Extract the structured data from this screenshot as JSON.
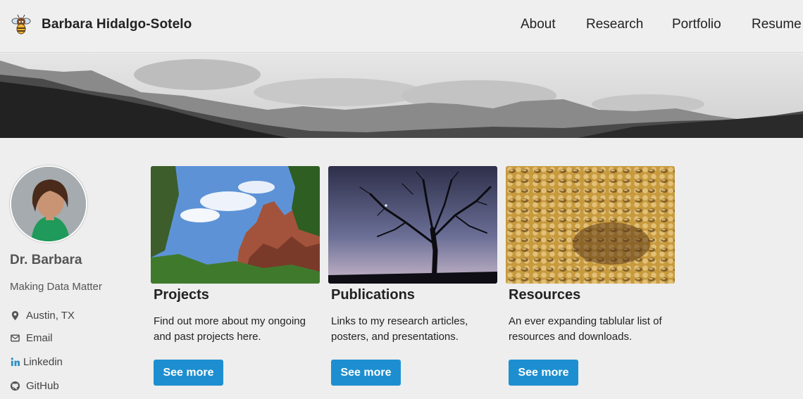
{
  "masthead": {
    "site_title": "Barbara Hidalgo-Sotelo",
    "logo_icon": "bee-logo-icon",
    "nav": [
      {
        "label": "About"
      },
      {
        "label": "Research"
      },
      {
        "label": "Portfolio"
      },
      {
        "label": "Resume"
      }
    ]
  },
  "hero": {
    "description": "mountain-panorama-grayscale"
  },
  "author": {
    "name": "Dr. Barbara",
    "bio": "Making Data Matter",
    "links": [
      {
        "label": "Austin, TX",
        "icon": "location-pin-icon"
      },
      {
        "label": "Email",
        "icon": "envelope-icon"
      },
      {
        "label": "Linkedin",
        "icon": "linkedin-icon"
      },
      {
        "label": "GitHub",
        "icon": "github-icon"
      }
    ]
  },
  "cards": [
    {
      "title": "Projects",
      "excerpt": "Find out more about my ongoing and past projects here.",
      "button": "See more"
    },
    {
      "title": "Publications",
      "excerpt": "Links to my research articles, posters, and presentations.",
      "button": "See more"
    },
    {
      "title": "Resources",
      "excerpt": "An ever expanding tablular list of resources and downloads.",
      "button": "See more"
    }
  ],
  "colors": {
    "accent": "#1d8fd0",
    "background": "#eeeeee",
    "linkedin": "#2a8ec5"
  }
}
